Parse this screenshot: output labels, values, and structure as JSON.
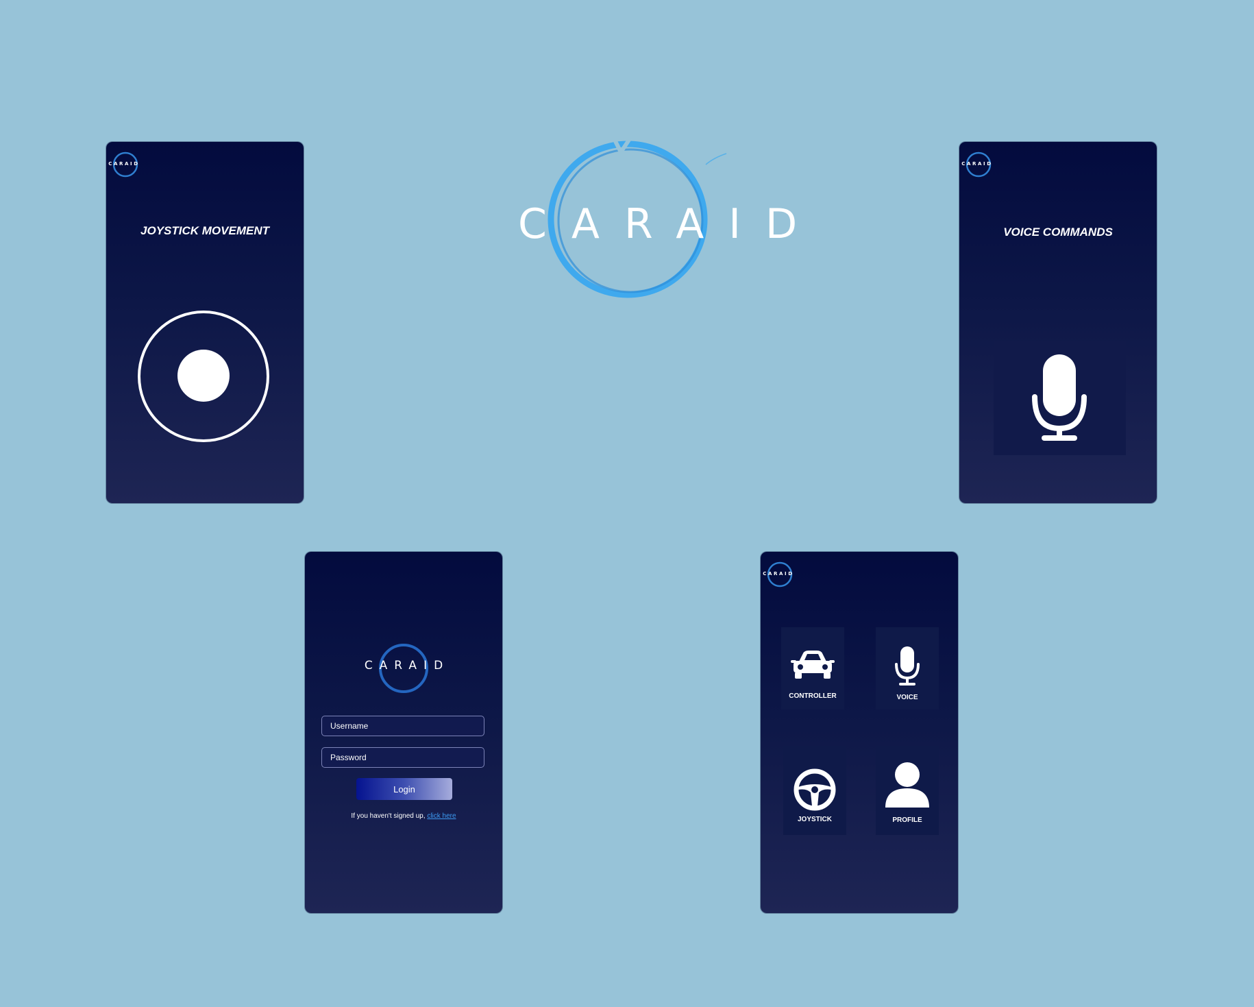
{
  "brand": {
    "name": "CARAID",
    "mini_name": "CARAID"
  },
  "joystick_screen": {
    "title": "JOYSTICK MOVEMENT"
  },
  "voice_screen": {
    "title": "VOICE COMMANDS"
  },
  "login_screen": {
    "username_placeholder": "Username",
    "password_placeholder": "Password",
    "login_label": "Login",
    "signup_text": "If you haven't signed up,",
    "signup_link": "click here"
  },
  "menu_screen": {
    "tiles": [
      {
        "label": "CONTROLLER",
        "icon": "car-icon"
      },
      {
        "label": "VOICE",
        "icon": "microphone-icon"
      },
      {
        "label": "JOYSTICK",
        "icon": "steering-wheel-icon"
      },
      {
        "label": "PROFILE",
        "icon": "person-icon"
      }
    ]
  },
  "colors": {
    "background": "#97c3d8",
    "screen_top": "#030b3e",
    "screen_bottom": "#1e2554",
    "logo_ring": "#3fa9ee",
    "link": "#3d9bf2"
  }
}
